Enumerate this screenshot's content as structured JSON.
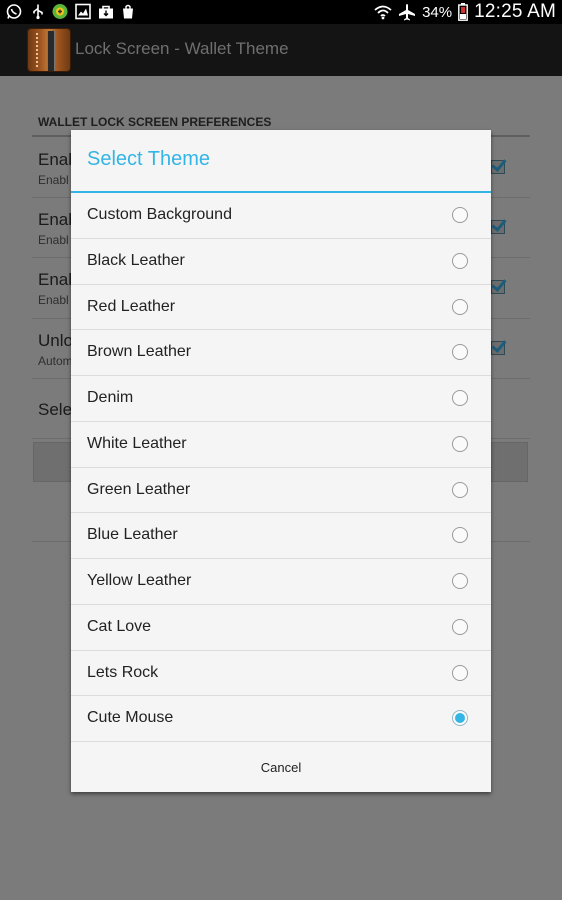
{
  "status_bar": {
    "battery": "34%",
    "time": "12:25 AM",
    "left_icons": [
      "whatsapp-icon",
      "usb-icon",
      "app-notification-icon",
      "image-icon",
      "bag-icon"
    ],
    "right_icons": [
      "wifi-icon",
      "airplane-icon",
      "battery-icon"
    ]
  },
  "action_bar": {
    "title": "Lock Screen - Wallet Theme"
  },
  "background_prefs": {
    "header": "WALLET LOCK SCREEN PREFERENCES",
    "items": [
      {
        "title": "Enab",
        "subtitle": "Enabl",
        "checked": true
      },
      {
        "title": "Enab",
        "subtitle": "Enabl",
        "checked": true
      },
      {
        "title": "Enab",
        "subtitle": "Enabl",
        "checked": true
      },
      {
        "title": "Unlo",
        "subtitle": "Autom",
        "checked": true
      },
      {
        "title": "Sele",
        "subtitle": "",
        "checked": false
      }
    ]
  },
  "dialog": {
    "title": "Select Theme",
    "options": [
      {
        "label": "Custom Background",
        "selected": false
      },
      {
        "label": "Black Leather",
        "selected": false
      },
      {
        "label": "Red Leather",
        "selected": false
      },
      {
        "label": "Brown Leather",
        "selected": false
      },
      {
        "label": "Denim",
        "selected": false
      },
      {
        "label": "White Leather",
        "selected": false
      },
      {
        "label": "Green Leather",
        "selected": false
      },
      {
        "label": "Blue Leather",
        "selected": false
      },
      {
        "label": "Yellow Leather",
        "selected": false
      },
      {
        "label": "Cat Love",
        "selected": false
      },
      {
        "label": "Lets Rock",
        "selected": false
      },
      {
        "label": "Cute Mouse",
        "selected": true
      }
    ],
    "cancel_label": "Cancel"
  },
  "colors": {
    "accent": "#33b5e5",
    "dim_background": "#7b7b7b"
  }
}
